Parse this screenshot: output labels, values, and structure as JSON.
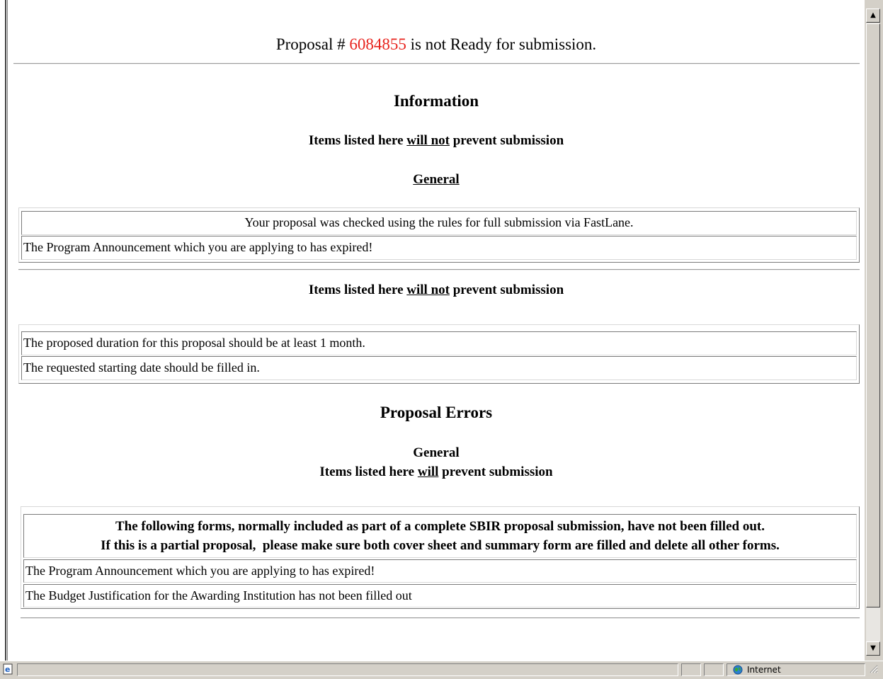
{
  "header": {
    "prefix": "Proposal #",
    "proposal_number": "6084855",
    "suffix": "is not Ready for submission."
  },
  "information": {
    "heading": "Information",
    "notice_pre": "Items listed here",
    "notice_emph": "will not",
    "notice_post": "prevent submission",
    "general_label": "General",
    "rows": [
      "Your proposal was checked using the rules for full submission via FastLane.",
      "The Program Announcement which you are applying to has expired!"
    ]
  },
  "warnings": {
    "notice_pre": "Items listed here",
    "notice_emph": "will not",
    "notice_post": "prevent submission",
    "rows": [
      "The proposed duration for this proposal should be at least 1 month.",
      "The requested starting date should be filled in."
    ]
  },
  "errors": {
    "heading": "Proposal Errors",
    "general_label": "General",
    "notice_pre": "Items listed here",
    "notice_emph": "will",
    "notice_post": "prevent submission",
    "forms_notice_line1": "The following forms, normally included as part of a complete SBIR proposal submission, have not been filled out.",
    "forms_notice_line2": "If this is a partial proposal,  please make sure both cover sheet and summary form are filled and delete all other forms.",
    "rows": [
      "The Program Announcement which you are applying to has expired!",
      "The Budget Justification for the Awarding Institution has not been filled out"
    ]
  },
  "statusbar": {
    "zone": "Internet",
    "page_icon": "ie-page-icon",
    "zone_icon": "globe-icon"
  },
  "scrollbar": {
    "up_icon": "▲",
    "down_icon": "▼"
  },
  "colors": {
    "proposal_number": "#e8231d",
    "chrome": "#d4d0c8"
  }
}
